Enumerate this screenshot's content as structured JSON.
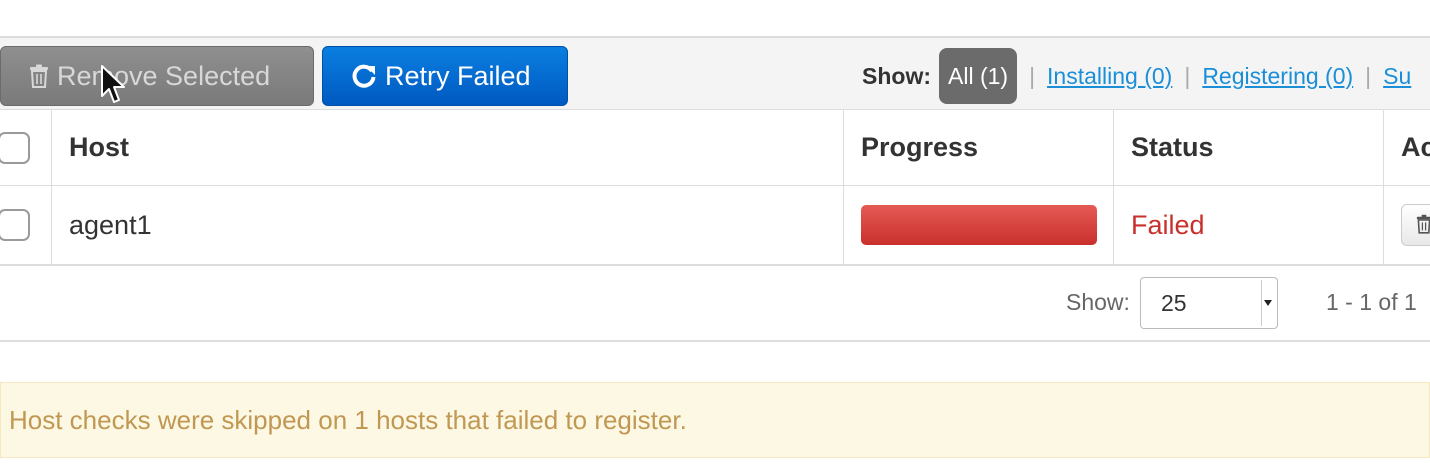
{
  "toolbar": {
    "remove_selected_label": "Remove Selected",
    "retry_failed_label": "Retry Failed",
    "filters": {
      "show_label": "Show:",
      "all": "All (1)",
      "installing": "Installing (0)",
      "registering": "Registering (0)",
      "success_partial": "Su",
      "separator": "|"
    }
  },
  "table": {
    "headers": {
      "host": "Host",
      "progress": "Progress",
      "status": "Status",
      "action_partial": "Ac"
    },
    "rows": [
      {
        "host": "agent1",
        "progress_percent": 100,
        "status": "Failed"
      }
    ]
  },
  "pagination": {
    "show_label": "Show:",
    "page_size": "25",
    "range_text": "1 - 1 of 1"
  },
  "alert": {
    "message": "Host checks were skipped on 1 hosts that failed to register."
  },
  "colors": {
    "retry_button": "#0064d2",
    "remove_button_disabled": "#808080",
    "failed_status": "#c9302c",
    "progress_failed": "#d9534f",
    "link": "#1a8fd8",
    "alert_bg": "#fcf8e3",
    "alert_text": "#c09853"
  },
  "icons": {
    "remove": "trash-icon",
    "retry": "refresh-icon",
    "row_action": "trash-icon",
    "cursor": "mouse-pointer-icon"
  }
}
